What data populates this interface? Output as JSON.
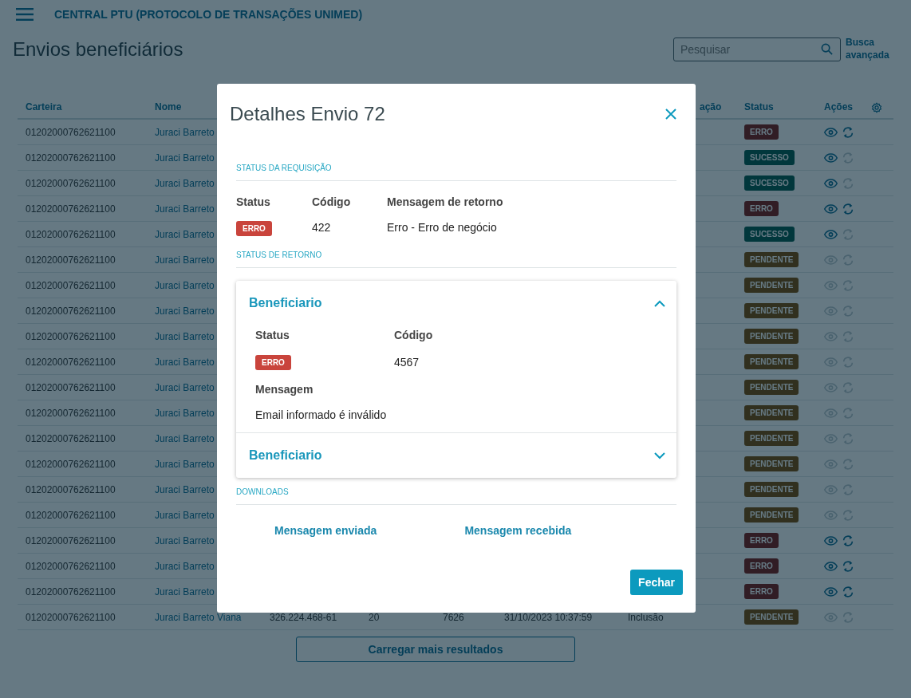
{
  "app_bar": {
    "title": "CENTRAL PTU (PROTOCOLO DE TRANSAÇÕES UNIMED)"
  },
  "page": {
    "title": "Envios beneficiários",
    "search": {
      "placeholder": "Pesquisar"
    },
    "advanced_search": "Busca avançada"
  },
  "table": {
    "columns": [
      {
        "label": "Carteira"
      },
      {
        "label": "Nome"
      },
      {
        "label": "ação"
      },
      {
        "label": "Status"
      },
      {
        "label": "Ações"
      }
    ],
    "rows": [
      {
        "carteira": "01202000762621100",
        "nome": "Juraci Barreto",
        "cells": [],
        "status": {
          "kind": "erro",
          "label": "ERRO"
        },
        "view_disabled": false,
        "resend_disabled": false
      },
      {
        "carteira": "01202000762621100",
        "nome": "Juraci Barreto",
        "cells": [],
        "status": {
          "kind": "sucesso",
          "label": "SUCESSO"
        },
        "view_disabled": false,
        "resend_disabled": true
      },
      {
        "carteira": "01202000762621100",
        "nome": "Juraci Barreto",
        "cells": [],
        "status": {
          "kind": "sucesso",
          "label": "SUCESSO"
        },
        "view_disabled": false,
        "resend_disabled": true
      },
      {
        "carteira": "01202000762621100",
        "nome": "Juraci Barreto",
        "cells": [],
        "status": {
          "kind": "erro",
          "label": "ERRO"
        },
        "view_disabled": false,
        "resend_disabled": false
      },
      {
        "carteira": "01202000762621100",
        "nome": "Juraci Barreto",
        "cells": [],
        "status": {
          "kind": "sucesso",
          "label": "SUCESSO"
        },
        "view_disabled": false,
        "resend_disabled": true
      },
      {
        "carteira": "01202000762621100",
        "nome": "Juraci Barreto",
        "cells": [],
        "status": {
          "kind": "pendente",
          "label": "PENDENTE"
        },
        "view_disabled": true,
        "resend_disabled": true
      },
      {
        "carteira": "01202000762621100",
        "nome": "Juraci Barreto",
        "cells": [],
        "status": {
          "kind": "pendente",
          "label": "PENDENTE"
        },
        "view_disabled": true,
        "resend_disabled": true
      },
      {
        "carteira": "01202000762621100",
        "nome": "Juraci Barreto",
        "cells": [],
        "status": {
          "kind": "pendente",
          "label": "PENDENTE"
        },
        "view_disabled": true,
        "resend_disabled": true
      },
      {
        "carteira": "01202000762621100",
        "nome": "Juraci Barreto",
        "cells": [],
        "status": {
          "kind": "pendente",
          "label": "PENDENTE"
        },
        "view_disabled": true,
        "resend_disabled": true
      },
      {
        "carteira": "01202000762621100",
        "nome": "Juraci Barreto",
        "cells": [],
        "status": {
          "kind": "pendente",
          "label": "PENDENTE"
        },
        "view_disabled": true,
        "resend_disabled": true
      },
      {
        "carteira": "01202000762621100",
        "nome": "Juraci Barreto",
        "cells": [],
        "status": {
          "kind": "pendente",
          "label": "PENDENTE"
        },
        "view_disabled": true,
        "resend_disabled": true
      },
      {
        "carteira": "01202000762621100",
        "nome": "Juraci Barreto",
        "cells": [],
        "status": {
          "kind": "pendente",
          "label": "PENDENTE"
        },
        "view_disabled": true,
        "resend_disabled": true
      },
      {
        "carteira": "01202000762621100",
        "nome": "Juraci Barreto",
        "cells": [],
        "status": {
          "kind": "pendente",
          "label": "PENDENTE"
        },
        "view_disabled": true,
        "resend_disabled": true
      },
      {
        "carteira": "01202000762621100",
        "nome": "Juraci Barreto",
        "cells": [],
        "status": {
          "kind": "pendente",
          "label": "PENDENTE"
        },
        "view_disabled": true,
        "resend_disabled": true
      },
      {
        "carteira": "01202000762621100",
        "nome": "Juraci Barreto",
        "cells": [],
        "status": {
          "kind": "pendente",
          "label": "PENDENTE"
        },
        "view_disabled": true,
        "resend_disabled": true
      },
      {
        "carteira": "01202000762621100",
        "nome": "Juraci Barreto",
        "cells": [],
        "status": {
          "kind": "pendente",
          "label": "PENDENTE"
        },
        "view_disabled": true,
        "resend_disabled": true
      },
      {
        "carteira": "01202000762621100",
        "nome": "Juraci Barreto",
        "cells": [],
        "status": {
          "kind": "erro",
          "label": "ERRO"
        },
        "view_disabled": false,
        "resend_disabled": false
      },
      {
        "carteira": "01202000762621100",
        "nome": "Juraci Barreto",
        "cells": [],
        "status": {
          "kind": "erro",
          "label": "ERRO"
        },
        "view_disabled": false,
        "resend_disabled": false
      },
      {
        "carteira": "01202000762621100",
        "nome": "Juraci Barreto",
        "cells": [],
        "status": {
          "kind": "erro",
          "label": "ERRO"
        },
        "view_disabled": false,
        "resend_disabled": false
      },
      {
        "carteira": "01202000762621100",
        "nome": "Juraci Barreto Viana",
        "cells": [
          "326.224.468-61",
          "20",
          "7626",
          "31/10/2023 10:37:59",
          "Inclusão"
        ],
        "status": {
          "kind": "pendente",
          "label": "PENDENTE"
        },
        "view_disabled": true,
        "resend_disabled": true
      }
    ],
    "load_more": "Carregar mais resultados"
  },
  "modal": {
    "title": "Detalhes Envio 72",
    "request_section": {
      "heading": "STATUS DA REQUISIÇÃO",
      "fields": [
        {
          "label": "Status",
          "kind": "badge",
          "badge": {
            "kind": "erro",
            "label": "ERRO"
          }
        },
        {
          "label": "Código",
          "kind": "text",
          "value": "422"
        },
        {
          "label": "Mensagem de retorno",
          "kind": "text",
          "value": "Erro - Erro de negócio"
        }
      ]
    },
    "return_section": {
      "heading": "STATUS DE RETORNO",
      "items": [
        {
          "title": "Beneficiario",
          "expanded": true,
          "status_label": "Status",
          "status": {
            "kind": "erro",
            "label": "ERRO"
          },
          "code_label": "Código",
          "code": "4567",
          "message_label": "Mensagem",
          "message": "Email informado é inválido"
        },
        {
          "title": "Beneficiario",
          "expanded": false
        }
      ]
    },
    "downloads": {
      "heading": "DOWNLOADS",
      "links": [
        "Mensagem enviada",
        "Mensagem recebida"
      ]
    },
    "close_button": "Fechar"
  }
}
